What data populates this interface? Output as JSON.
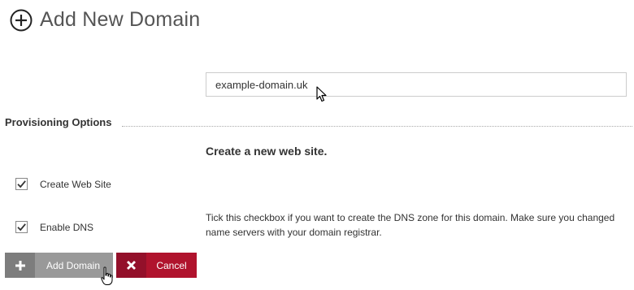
{
  "header": {
    "title": "Add New Domain",
    "icon": "plus-circle-icon"
  },
  "domain": {
    "value": "example-domain.uk"
  },
  "provisioning": {
    "section_title": "Provisioning Options",
    "subtitle": "Create a new web site.",
    "options": [
      {
        "label": "Create Web Site",
        "checked": true
      },
      {
        "label": "Enable DNS",
        "checked": true
      }
    ],
    "help_text": "Tick this checkbox if you want to create the DNS zone for this domain. Make sure you changed name servers with your domain registrar."
  },
  "actions": {
    "add_label": "Add Domain",
    "add_icon": "plus-icon",
    "cancel_label": "Cancel",
    "cancel_icon": "x-icon"
  },
  "colors": {
    "add_button": "#999999",
    "cancel_button": "#b0132d",
    "title_text": "#555555"
  }
}
